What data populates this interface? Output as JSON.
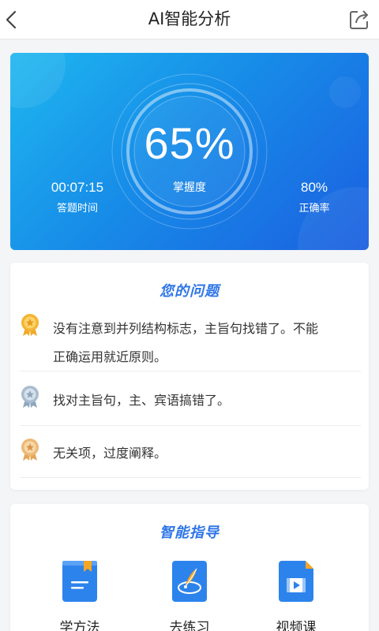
{
  "header": {
    "title": "AI智能分析",
    "back_icon": "chevron-left-icon",
    "share_icon": "share-icon"
  },
  "score": {
    "percent": "65%",
    "percent_label": "掌握度",
    "time_value": "00:07:15",
    "time_label": "答题时间",
    "accuracy_value": "80%",
    "accuracy_label": "正确率"
  },
  "problems": {
    "title": "您的问题",
    "items": [
      {
        "text_line1": "没有注意到并列结构标志，主旨句找错了。不能",
        "text_line2": "正确运用就近原则。",
        "medal": "gold-medal-icon"
      },
      {
        "text_line1": "找对主旨句，主、宾语搞错了。",
        "medal": "silver-medal-icon"
      },
      {
        "text_line1": "无关项，过度阐释。",
        "medal": "bronze-medal-icon"
      }
    ]
  },
  "guide": {
    "title": "智能指导",
    "items": [
      {
        "label": "学方法",
        "icon": "book-icon"
      },
      {
        "label": "去练习",
        "icon": "quill-icon"
      },
      {
        "label": "视频课",
        "icon": "video-file-icon"
      }
    ]
  },
  "colors": {
    "accent": "#2f76e8",
    "card_gradient_start": "#1fb7ef",
    "card_gradient_end": "#1b5fe0",
    "medal_gold": "#f4b533",
    "medal_silver": "#9fb4c9",
    "medal_bronze": "#e9b46a"
  }
}
